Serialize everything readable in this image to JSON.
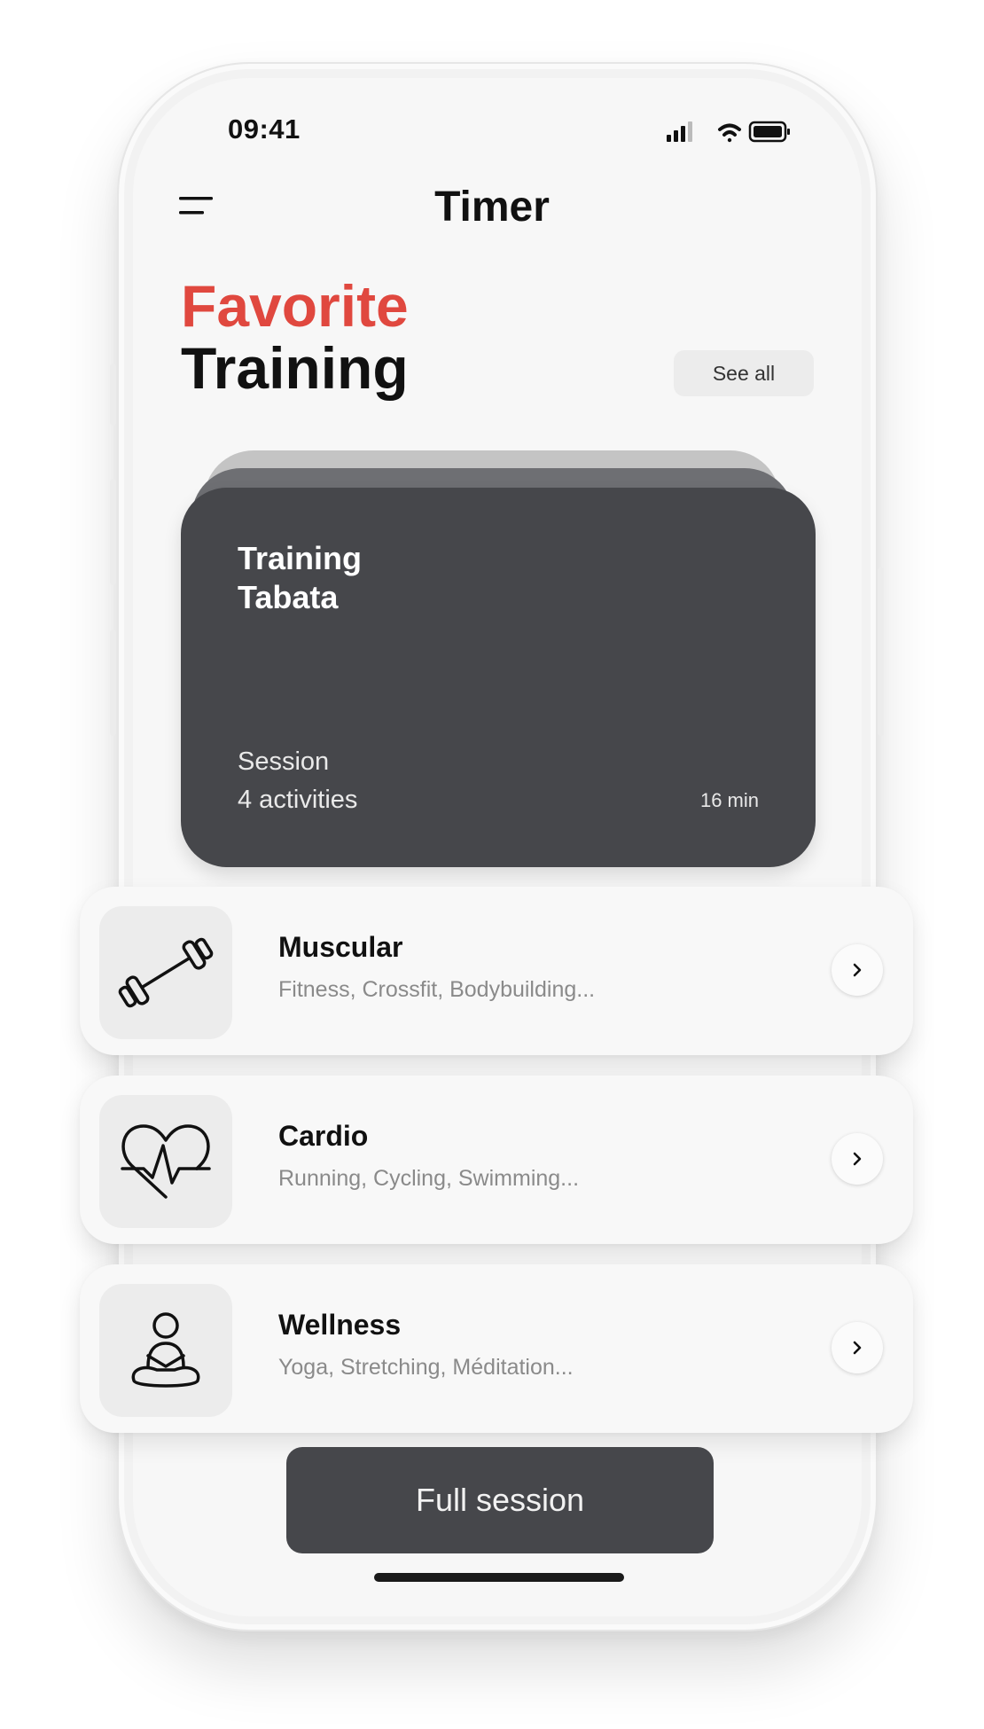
{
  "status_bar": {
    "time": "09:41",
    "icons": [
      "signal-icon",
      "wifi-icon",
      "battery-icon"
    ]
  },
  "header": {
    "title": "Timer",
    "menu_icon": "hamburger-menu-icon"
  },
  "section": {
    "title_line1": "Favorite",
    "title_line2": "Training",
    "see_all_label": "See all"
  },
  "featured_card": {
    "title_line1": "Training",
    "title_line2": "Tabata",
    "subtitle_line1": "Session",
    "subtitle_line2": "4 activities",
    "duration": "16 min"
  },
  "categories": [
    {
      "title": "Muscular",
      "subtitle": "Fitness, Crossfit, Bodybuilding...",
      "icon": "dumbbell-icon"
    },
    {
      "title": "Cardio",
      "subtitle": "Running, Cycling, Swimming...",
      "icon": "heart-pulse-icon"
    },
    {
      "title": "Wellness",
      "subtitle": "Yoga, Stretching, Méditation...",
      "icon": "meditation-icon"
    }
  ],
  "primary_action": {
    "label": "Full session"
  },
  "colors": {
    "accent": "#e0483f",
    "card_dark": "#46474b",
    "background": "#f7f7f7",
    "text_primary": "#111111",
    "text_secondary": "#8a8a8a"
  }
}
